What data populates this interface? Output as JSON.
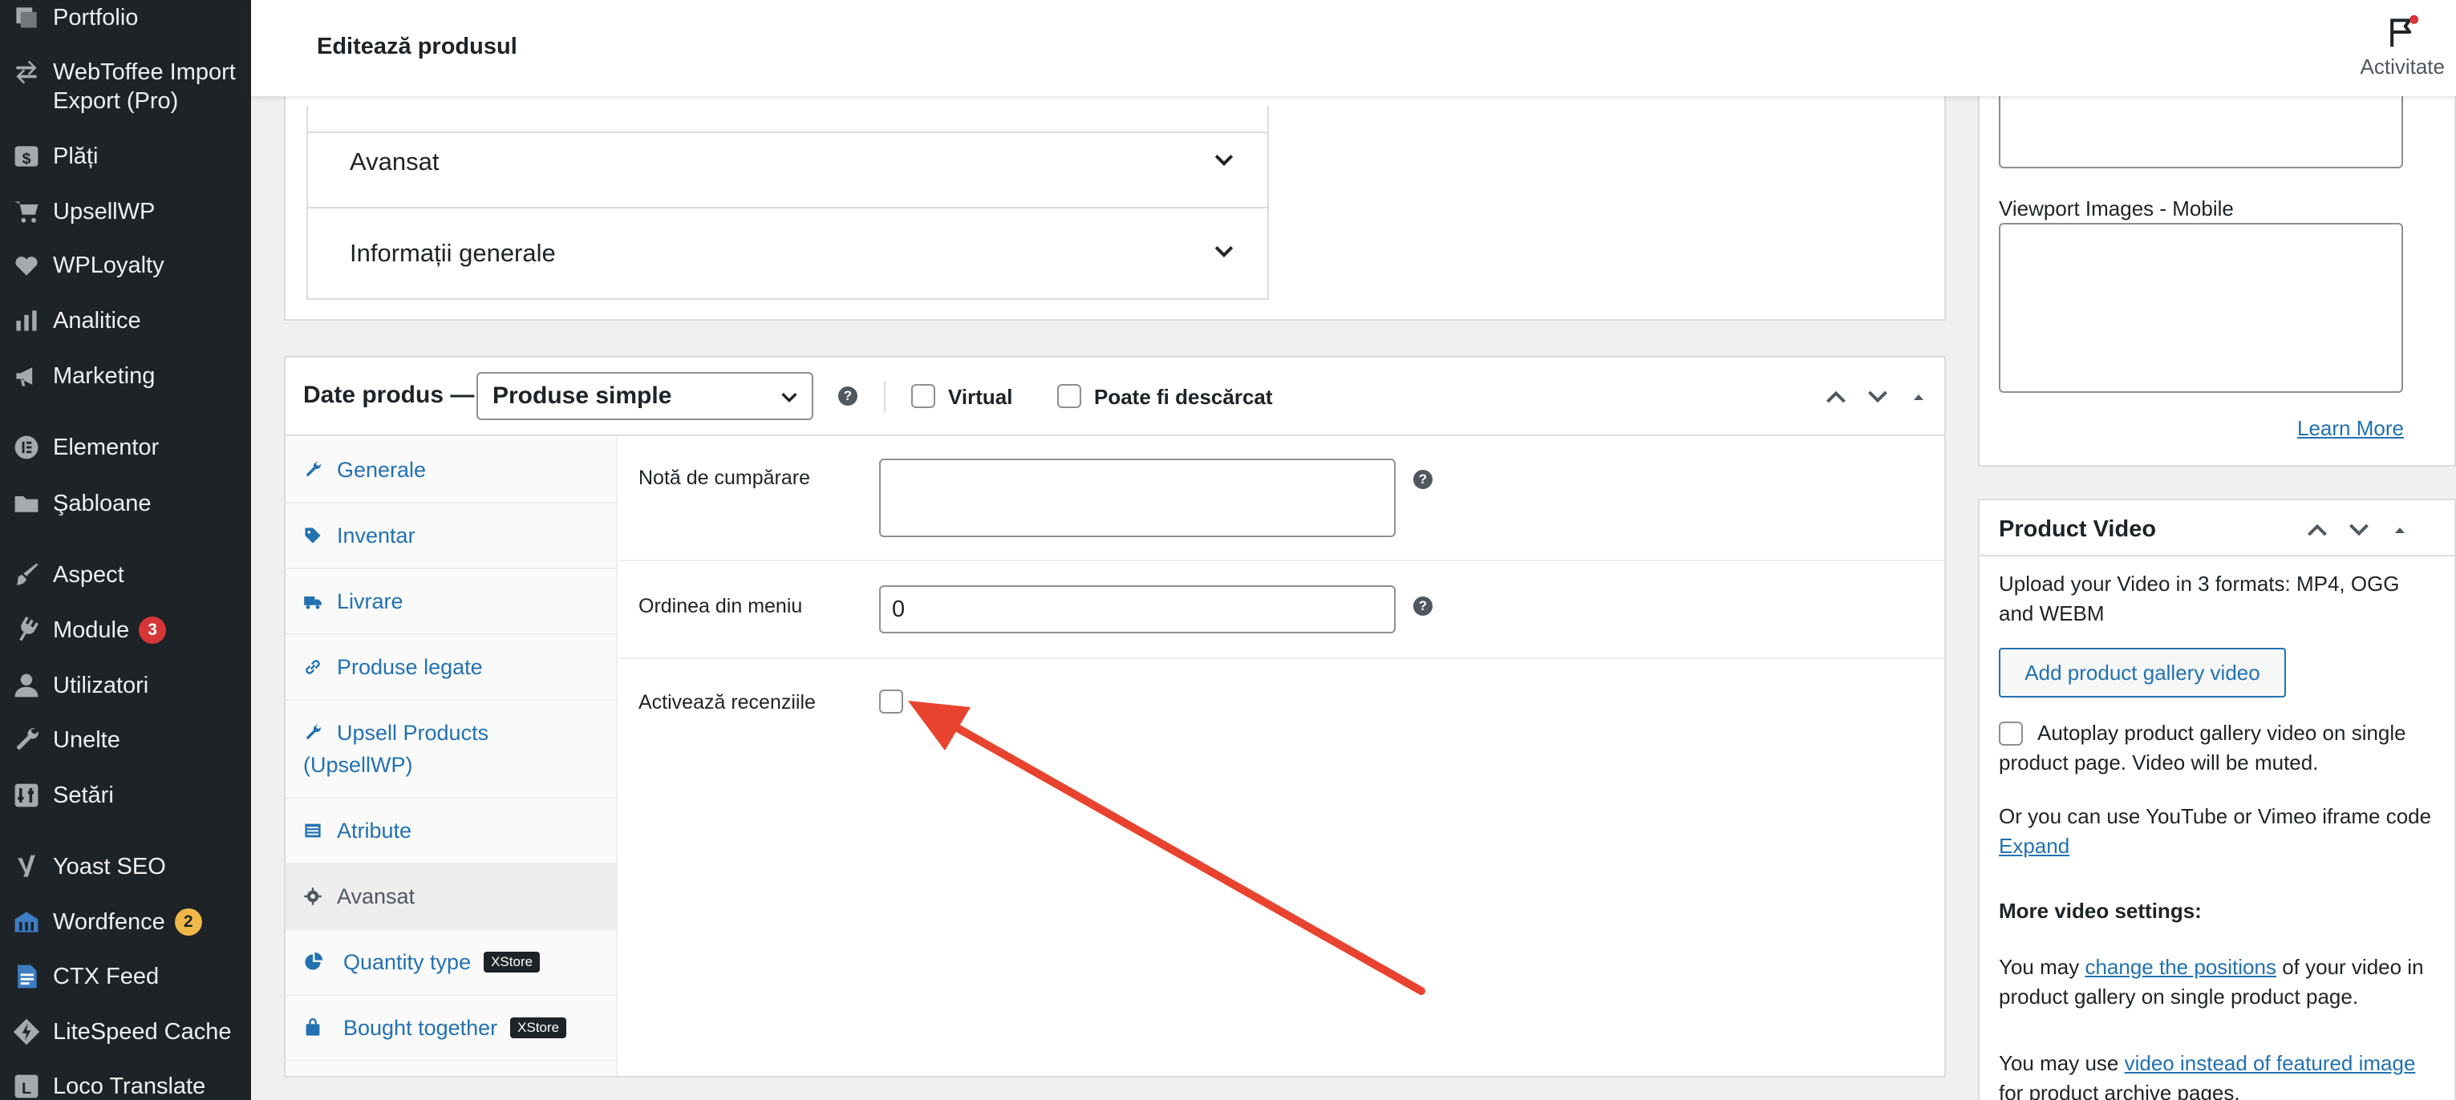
{
  "sidebar": {
    "items": [
      {
        "label": "Portfolio",
        "icon": "portfolio-icon"
      },
      {
        "label": "WebToffee Import Export (Pro)",
        "icon": "import-export-icon"
      },
      {
        "label": "Plăți",
        "icon": "payments-icon"
      },
      {
        "label": "UpsellWP",
        "icon": "cart-icon"
      },
      {
        "label": "WPLoyalty",
        "icon": "loyalty-icon"
      },
      {
        "label": "Analitice",
        "icon": "analytics-icon"
      },
      {
        "label": "Marketing",
        "icon": "megaphone-icon"
      },
      {
        "label": "Elementor",
        "icon": "elementor-icon"
      },
      {
        "label": "Şabloane",
        "icon": "folder-icon"
      },
      {
        "label": "Aspect",
        "icon": "paintbrush-icon"
      },
      {
        "label": "Module",
        "icon": "plugin-icon",
        "badge": "3"
      },
      {
        "label": "Utilizatori",
        "icon": "user-icon"
      },
      {
        "label": "Unelte",
        "icon": "wrench-icon"
      },
      {
        "label": "Setări",
        "icon": "settings-icon"
      },
      {
        "label": "Yoast SEO",
        "icon": "yoast-icon"
      },
      {
        "label": "Wordfence",
        "icon": "wordfence-icon",
        "badge": "2"
      },
      {
        "label": "CTX Feed",
        "icon": "feed-icon"
      },
      {
        "label": "LiteSpeed Cache",
        "icon": "litespeed-icon"
      },
      {
        "label": "Loco Translate",
        "icon": "translate-icon"
      }
    ]
  },
  "header": {
    "title": "Editează produsul",
    "activity_label": "Activitate"
  },
  "accordion": {
    "rows": [
      {
        "label": "Avansat"
      },
      {
        "label": "Informații generale"
      }
    ]
  },
  "product_data": {
    "title": "Date produs —",
    "type_select": "Produse simple",
    "virtual_label": "Virtual",
    "downloadable_label": "Poate fi descărcat",
    "tabs": [
      {
        "label": "Generale",
        "icon": "wrench-icon"
      },
      {
        "label": "Inventar",
        "icon": "tag-icon"
      },
      {
        "label": "Livrare",
        "icon": "truck-icon"
      },
      {
        "label": "Produse legate",
        "icon": "link-icon"
      },
      {
        "label": "Upsell Products (UpsellWP)",
        "icon": "wrench-icon"
      },
      {
        "label": "Atribute",
        "icon": "list-icon"
      },
      {
        "label": "Avansat",
        "icon": "gear-icon",
        "active": true
      },
      {
        "label": "Quantity type",
        "icon": "pie-icon",
        "badge": "XStore"
      },
      {
        "label": "Bought together",
        "icon": "bag-icon",
        "badge": "XStore"
      }
    ],
    "fields": {
      "purchase_note_label": "Notă de cumpărare",
      "purchase_note_value": "",
      "menu_order_label": "Ordinea din meniu",
      "menu_order_value": "0",
      "enable_reviews_label": "Activează recenziile"
    }
  },
  "right_column": {
    "viewport_mobile_label": "Viewport Images - Mobile",
    "learn_more": "Learn More",
    "product_video": {
      "title": "Product Video",
      "upload_text": "Upload your Video in 3 formats: MP4, OGG and WEBM",
      "add_button": "Add product gallery video",
      "autoplay_text": "Autoplay product gallery video on single product page. Video will be muted.",
      "iframe_text": "Or you can use YouTube or Vimeo iframe code",
      "expand_link": "Expand",
      "more_settings": "More video settings:",
      "positions_prefix": "You may",
      "positions_link": "change the positions",
      "positions_suffix": "of your video in product gallery on single product page.",
      "featured_prefix": "You may use",
      "featured_link": "video instead of featured image",
      "featured_suffix": "for product archive pages."
    }
  },
  "colors": {
    "sidebar_bg": "#1d2327",
    "accent": "#2271b1",
    "badge_red": "#d63638",
    "badge_orange": "#f0b849",
    "arrow": "#e8432e"
  }
}
